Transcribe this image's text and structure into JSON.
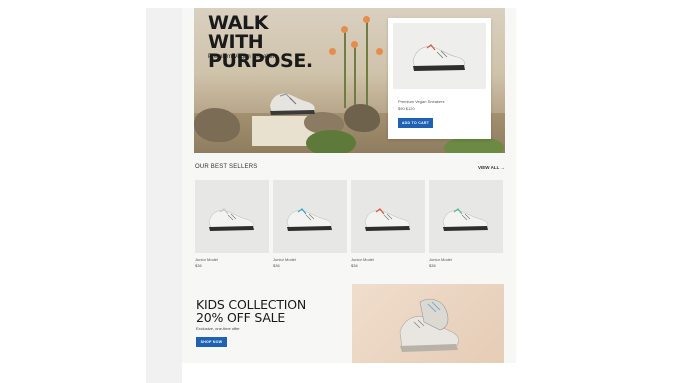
{
  "hero": {
    "title": "WALK WITH PURPOSE.",
    "subtitle": "Premium Vegan Sneakers",
    "card": {
      "product_name": "Premium Vegan Sneakers",
      "price": "$90 $120",
      "button_label": "ADD TO CART"
    }
  },
  "best_sellers": {
    "title": "OUR BEST SELLERS",
    "view_all_label": "VIEW ALL →",
    "products": [
      {
        "name": "Junior Model",
        "price": "$36",
        "accent": "#c9c9c9"
      },
      {
        "name": "Junior Model",
        "price": "$36",
        "accent": "#3fa7c9"
      },
      {
        "name": "Junior Model",
        "price": "$36",
        "accent": "#e0583a"
      },
      {
        "name": "Junior Model",
        "price": "$36",
        "accent": "#5db7a4"
      }
    ]
  },
  "kids_promo": {
    "title_line1": "KIDS COLLECTION",
    "title_line2": "20% OFF SALE",
    "subtitle": "Exclusive, one-time offer",
    "button_label": "SHOP NOW"
  },
  "colors": {
    "button": "#1f62b3",
    "page_bg": "#f7f7f6"
  }
}
